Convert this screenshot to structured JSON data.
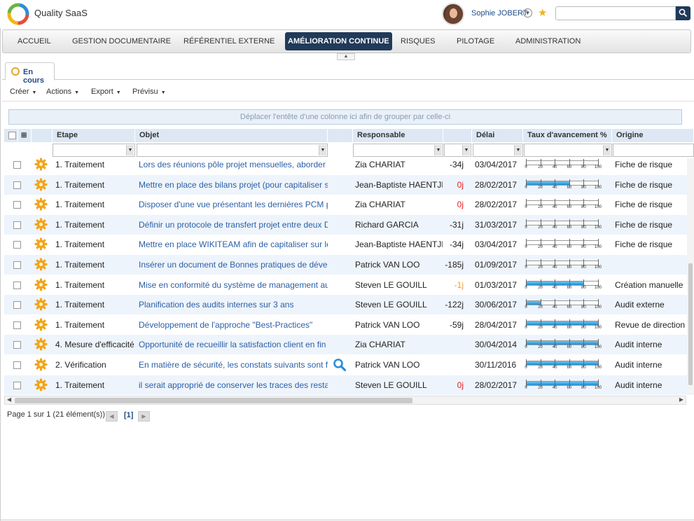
{
  "app": {
    "title": "Quality SaaS"
  },
  "user": {
    "name": "Sophie JOBERT"
  },
  "nav": {
    "items": [
      "ACCUEIL",
      "GESTION DOCUMENTAIRE",
      "RÉFÉRENTIEL EXTERNE",
      "AMÉLIORATION CONTINUE",
      "RISQUES",
      "PILOTAGE",
      "ADMINISTRATION"
    ],
    "active": "AMÉLIORATION CONTINUE"
  },
  "tabs": {
    "current": "En cours"
  },
  "toolbar": {
    "create": "Créer",
    "actions": "Actions",
    "export": "Export",
    "preview": "Prévisu"
  },
  "grid": {
    "group_hint": "Déplacer l'entête d'une colonne ici afin de grouper par celle-ci",
    "columns": {
      "etape": "Etape",
      "objet": "Objet",
      "responsable": "Responsable",
      "delai": "Délai",
      "taux": "Taux d'avancement %",
      "origine": "Origine"
    },
    "progress_ticks": [
      "0",
      "20",
      "40",
      "60",
      "80",
      "100"
    ],
    "rows": [
      {
        "etape": "1. Traitement",
        "objet": "Lors des réunions pôle projet mensuelles, aborder les c",
        "responsable": "Zia CHARIAT",
        "delai": "-34j",
        "delai_color": "black",
        "date": "03/04/2017",
        "progress": 0,
        "origine": "Fiche de risque"
      },
      {
        "etape": "1. Traitement",
        "objet": "Mettre en place des bilans projet (pour capitaliser sur le",
        "responsable": "Jean-Baptiste HAENTJENS",
        "delai": "0j",
        "delai_color": "red",
        "date": "28/02/2017",
        "progress": 60,
        "origine": "Fiche de risque"
      },
      {
        "etape": "1. Traitement",
        "objet": "Disposer d'une vue présentant les dernières PCM publi",
        "responsable": "Zia CHARIAT",
        "delai": "0j",
        "delai_color": "red",
        "date": "28/02/2017",
        "progress": 0,
        "origine": "Fiche de risque"
      },
      {
        "etape": "1. Traitement",
        "objet": "Définir un protocole de transfert projet entre deux DPs",
        "responsable": "Richard GARCIA",
        "delai": "-31j",
        "delai_color": "black",
        "date": "31/03/2017",
        "progress": 0,
        "origine": "Fiche de risque"
      },
      {
        "etape": "1. Traitement",
        "objet": "Mettre en place WIKITEAM afin de capitaliser sur les c",
        "responsable": "Jean-Baptiste HAENTJENS",
        "delai": "-34j",
        "delai_color": "black",
        "date": "03/04/2017",
        "progress": 0,
        "origine": "Fiche de risque"
      },
      {
        "etape": "1. Traitement",
        "objet": "Insérer un document de Bonnes pratiques de développ",
        "responsable": "Patrick VAN LOO",
        "delai": "-185j",
        "delai_color": "black",
        "date": "01/09/2017",
        "progress": 0,
        "origine": ""
      },
      {
        "etape": "1. Traitement",
        "objet": "Mise en conformité du système de management aux n",
        "responsable": "Steven LE GOUILL",
        "delai": "-1j",
        "delai_color": "orange",
        "date": "01/03/2017",
        "progress": 80,
        "origine": "Création manuelle"
      },
      {
        "etape": "1. Traitement",
        "objet": "Planification des audits internes sur 3 ans",
        "responsable": "Steven LE GOUILL",
        "delai": "-122j",
        "delai_color": "black",
        "date": "30/06/2017",
        "progress": 20,
        "origine": "Audit externe"
      },
      {
        "etape": "1. Traitement",
        "objet": "Développement de l'approche \"Best-Practices\"",
        "responsable": "Patrick VAN LOO",
        "delai": "-59j",
        "delai_color": "black",
        "date": "28/04/2017",
        "progress": 100,
        "origine": "Revue de direction"
      },
      {
        "etape": "4. Mesure d'efficacité",
        "objet": "Opportunité de recueillir la satisfaction client en fin de",
        "responsable": "Zia CHARIAT",
        "delai": "",
        "delai_color": "black",
        "date": "30/04/2014",
        "progress": 100,
        "origine": "Audit interne"
      },
      {
        "etape": "2. Vérification",
        "objet": "En matière de sécurité, les constats suivants sont form",
        "responsable": "Patrick VAN LOO",
        "delai": "",
        "delai_color": "black",
        "date": "30/11/2016",
        "progress": 100,
        "origine": "Audit interne"
      },
      {
        "etape": "1. Traitement",
        "objet": "il serait approprié de conserver les traces des restaurat",
        "responsable": "Steven LE GOUILL",
        "delai": "0j",
        "delai_color": "red",
        "date": "28/02/2017",
        "progress": 100,
        "origine": "Audit interne"
      }
    ]
  },
  "pager": {
    "summary": "Page 1 sur 1 (21 élément(s))",
    "current": "[1]"
  },
  "colors": {
    "nav_active": "#213a59",
    "link": "#2b5fa7",
    "late": "#e02020",
    "warning": "#f39a2a",
    "progress": "#1c8fd6"
  }
}
